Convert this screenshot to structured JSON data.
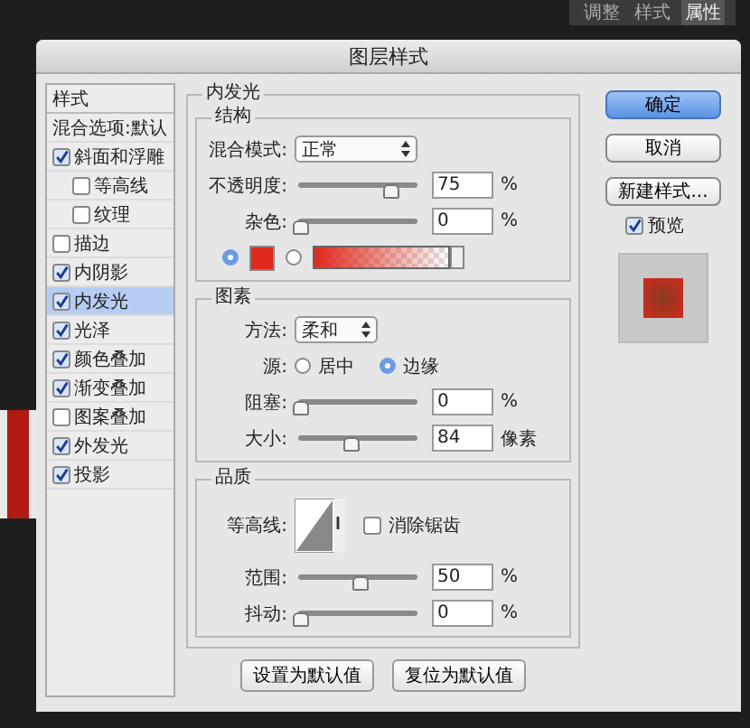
{
  "background_panel": {
    "tabs": [
      {
        "label": "调整",
        "selected": false
      },
      {
        "label": "样式",
        "selected": false
      },
      {
        "label": "属性",
        "selected": true
      }
    ]
  },
  "dialog": {
    "title": "图层样式"
  },
  "sidebar": {
    "header": "样式",
    "items": [
      {
        "label": "混合选项:默认",
        "kind": "plain",
        "selected": false
      },
      {
        "label": "斜面和浮雕",
        "kind": "check",
        "checked": true,
        "selected": false,
        "children": [
          {
            "label": "等高线",
            "checked": false
          },
          {
            "label": "纹理",
            "checked": false
          }
        ]
      },
      {
        "label": "描边",
        "kind": "check",
        "checked": false,
        "selected": false
      },
      {
        "label": "内阴影",
        "kind": "check",
        "checked": true,
        "selected": false
      },
      {
        "label": "内发光",
        "kind": "check",
        "checked": true,
        "selected": true
      },
      {
        "label": "光泽",
        "kind": "check",
        "checked": true,
        "selected": false
      },
      {
        "label": "颜色叠加",
        "kind": "check",
        "checked": true,
        "selected": false
      },
      {
        "label": "渐变叠加",
        "kind": "check",
        "checked": true,
        "selected": false
      },
      {
        "label": "图案叠加",
        "kind": "check",
        "checked": false,
        "selected": false
      },
      {
        "label": "外发光",
        "kind": "check",
        "checked": true,
        "selected": false
      },
      {
        "label": "投影",
        "kind": "check",
        "checked": true,
        "selected": false
      }
    ]
  },
  "panel": {
    "title": "内发光",
    "structure": {
      "title": "结构",
      "blend_mode": {
        "label": "混合模式:",
        "value": "正常"
      },
      "sliders": [
        {
          "label": "不透明度:",
          "level": 0.75,
          "value": "75",
          "unit": "%"
        },
        {
          "label": "杂色:",
          "level": 0,
          "value": "0",
          "unit": "%"
        }
      ],
      "fill": [
        {
          "kind": "color",
          "selected": true,
          "color": "#e0281c"
        },
        {
          "kind": "gradient",
          "selected": false
        }
      ]
    },
    "elements": {
      "title": "图素",
      "technique": {
        "label": "方法:",
        "value": "柔和"
      },
      "source": {
        "label": "源:",
        "options": [
          {
            "label": "居中",
            "selected": false
          },
          {
            "label": "边缘",
            "selected": true
          }
        ]
      },
      "sliders": [
        {
          "label": "阻塞:",
          "level": 0,
          "value": "0",
          "unit": "%"
        },
        {
          "label": "大小:",
          "level": 0.42,
          "value": "84",
          "unit": "像素"
        }
      ]
    },
    "quality": {
      "title": "品质",
      "contour": {
        "label": "等高线:"
      },
      "antialias": {
        "label": "消除锯齿",
        "checked": false
      },
      "sliders": [
        {
          "label": "范围:",
          "level": 0.5,
          "value": "50",
          "unit": "%"
        },
        {
          "label": "抖动:",
          "level": 0,
          "value": "0",
          "unit": "%"
        }
      ]
    },
    "buttons": [
      "设置为默认值",
      "复位为默认值"
    ]
  },
  "actions": [
    {
      "label": "确定",
      "kind": "primary"
    },
    {
      "label": "取消",
      "kind": "normal"
    },
    {
      "label": "新建样式...",
      "kind": "normal"
    }
  ],
  "preview": {
    "label": "预览",
    "checked": true
  }
}
